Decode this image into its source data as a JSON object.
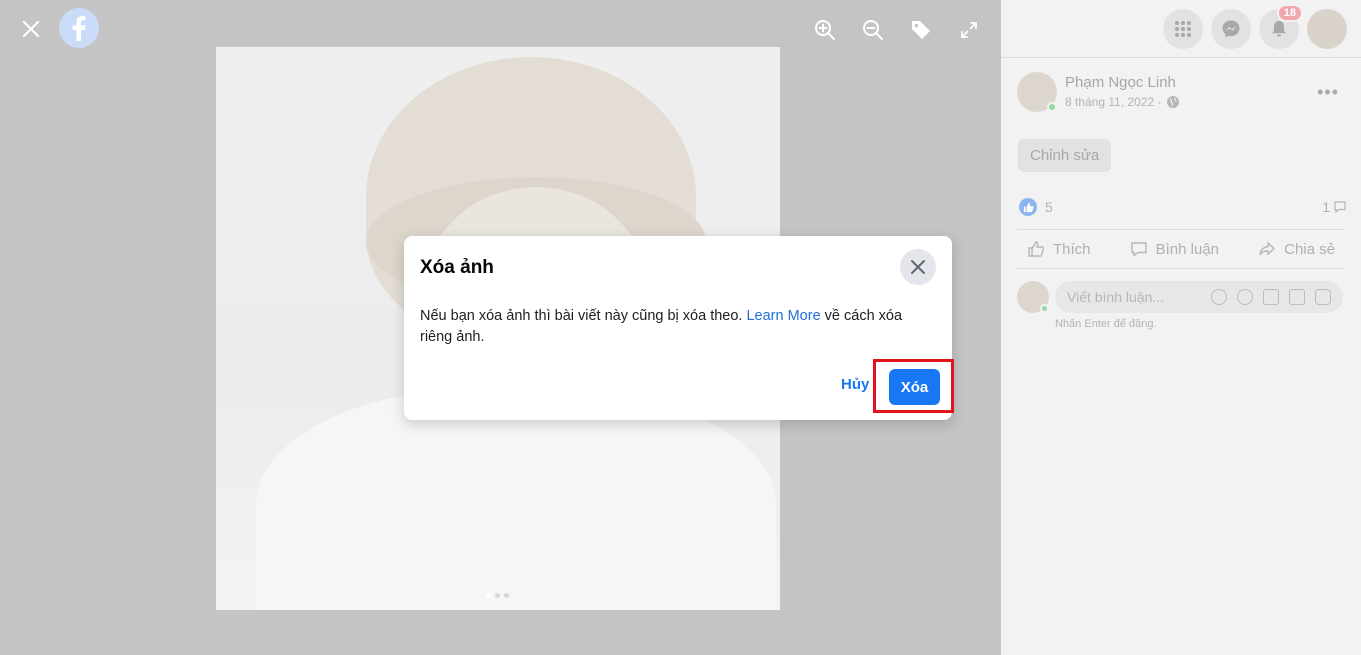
{
  "viewer": {
    "close_icon": "close-icon",
    "logo_icon": "facebook-logo-icon",
    "tools": [
      "zoom-in-icon",
      "zoom-out-icon",
      "tag-icon",
      "fullscreen-icon"
    ]
  },
  "side": {
    "notification_count": "18",
    "author": "Phạm Ngọc Linh",
    "date": "8 tháng 11, 2022 ·",
    "edit_label": "Chỉnh sửa",
    "reaction_count": "5",
    "comment_count": "1",
    "like_label": "Thích",
    "comment_label": "Bình luận",
    "share_label": "Chia sẻ",
    "comment_placeholder": "Viết bình luận...",
    "enter_hint": "Nhấn Enter để đăng."
  },
  "modal": {
    "title": "Xóa ảnh",
    "body_prefix": "Nếu bạn xóa ảnh thì bài viết này cũng bị xóa theo. ",
    "link_text": "Learn More",
    "body_suffix": " về cách xóa riêng ảnh.",
    "cancel_label": "Hủy",
    "confirm_label": "Xóa"
  },
  "colors": {
    "accent": "#1877f2",
    "highlight": "#e0141b"
  }
}
